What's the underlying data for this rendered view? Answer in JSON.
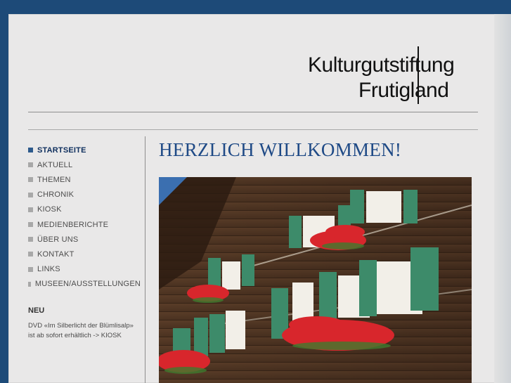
{
  "logo": {
    "line1": "Kulturgutstiftung",
    "line2": "Frutigland"
  },
  "nav": {
    "items": [
      {
        "label": "STARTSEITE",
        "active": true
      },
      {
        "label": "AKTUELL"
      },
      {
        "label": "THEMEN"
      },
      {
        "label": "CHRONIK"
      },
      {
        "label": "KIOSK"
      },
      {
        "label": "MEDIENBERICHTE"
      },
      {
        "label": "ÜBER UNS"
      },
      {
        "label": "KONTAKT"
      },
      {
        "label": "LINKS"
      },
      {
        "label": "MUSEEN/AUSSTELLUNGEN"
      }
    ]
  },
  "news": {
    "heading": "NEU",
    "line1": "DVD «Im Silberlicht der Blümlisalp»",
    "line2": "ist ab sofort erhältlich -> KIOSK"
  },
  "main": {
    "headline": "HERZLICH WILLKOMMEN!"
  },
  "colors": {
    "background": "#1d4a78",
    "paper": "#e9e8e8",
    "accent": "#1f4a86",
    "nav_text": "#4d4d4d"
  }
}
